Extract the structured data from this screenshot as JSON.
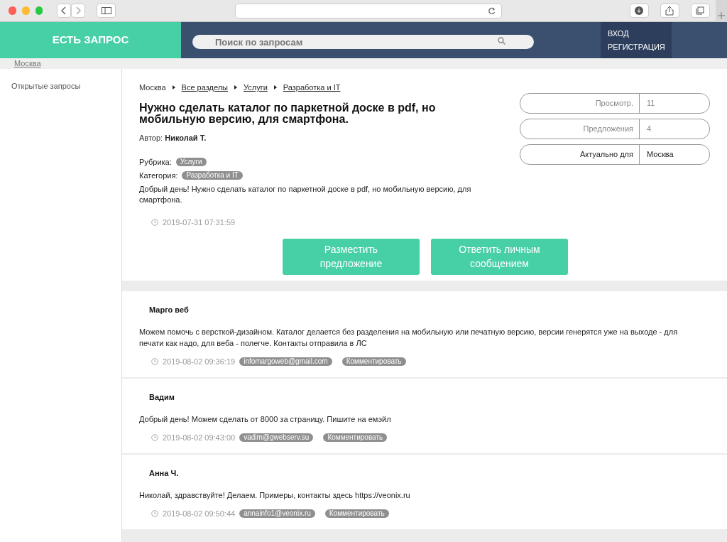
{
  "header": {
    "logo": "ЕСТЬ ЗАПРОС",
    "search": {
      "placeholder": "Поиск по запросам"
    },
    "auth": [
      "ВХОД",
      "РЕГИСТРАЦИЯ"
    ]
  },
  "city_link": "Москва",
  "sidebar": {
    "items": [
      "Открытые запросы"
    ]
  },
  "breadcrumbs": [
    {
      "label": "Москва",
      "link": false
    },
    {
      "label": "Все разделы",
      "link": true
    },
    {
      "label": "Услуги",
      "link": true
    },
    {
      "label": "Разработка и IT",
      "link": true
    }
  ],
  "request": {
    "title": "Нужно сделать каталог по паркетной доске в pdf, но мобильную версию, для смартфона.",
    "author_label": "Автор:",
    "author": "Николай Т.",
    "rubric_label": "Рубрика:",
    "rubric": "Услуги",
    "category_label": "Категория:",
    "category": "Разработка и IT",
    "text": "Добрый день! Нужно сделать каталог по паркетной доске в pdf, но мобильную версию, для смартфона.",
    "date": "2019-07-31 07:31:59"
  },
  "stats": [
    {
      "label": "Просмотр.",
      "value": "11",
      "emphasis": false
    },
    {
      "label": "Предложения",
      "value": "4",
      "emphasis": false
    },
    {
      "label": "Актуально для",
      "value": "Москва",
      "emphasis": true
    }
  ],
  "buttons": [
    "Разместить предложение",
    "Ответить личным сообщением"
  ],
  "responses": [
    {
      "author": "Марго веб",
      "text": "Можем помочь с версткой-дизайном. Каталог делается без разделения на мобильную или печатную версию, версии генерятся уже на выходе - для печати как надо, для веба - полегче. Контакты отправила в ЛС",
      "date": "2019-08-02 09:36:19",
      "email": "infomargoweb@gmail.com",
      "comment": "Комментировать"
    },
    {
      "author": "Вадим",
      "text": "Добрый день! Можем сделать от 8000 за страницу. Пишите на емэйл",
      "date": "2019-08-02 09:43:00",
      "email": "vadim@gwebserv.su",
      "comment": "Комментировать"
    },
    {
      "author": "Анна Ч.",
      "text": "Николай, здравствуйте! Делаем. Примеры, контакты здесь https://veonix.ru",
      "date": "2019-08-02 09:50:44",
      "email": "annainfo1@veonix.ru",
      "comment": "Комментировать"
    }
  ]
}
